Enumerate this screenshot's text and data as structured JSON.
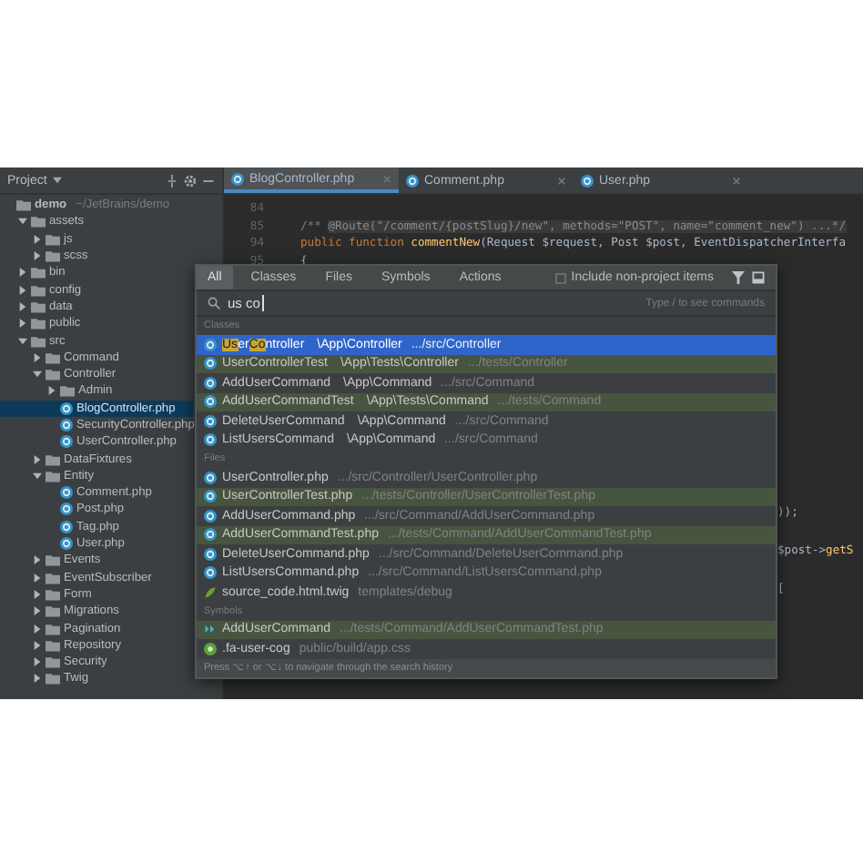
{
  "project_panel": {
    "title": "Project",
    "tree": [
      {
        "name": "demo",
        "path": "~/JetBrains/demo",
        "kind": "folder",
        "selected": false,
        "children": [
          {
            "name": "assets",
            "kind": "folder",
            "expanded": true,
            "selected": false,
            "children": [
              {
                "name": "js",
                "kind": "folder",
                "expanded": false,
                "selected": false
              },
              {
                "name": "scss",
                "kind": "folder",
                "expanded": false,
                "selected": false
              }
            ]
          },
          {
            "name": "bin",
            "kind": "folder",
            "expanded": false,
            "selected": false
          },
          {
            "name": "config",
            "kind": "folder",
            "expanded": false,
            "selected": false
          },
          {
            "name": "data",
            "kind": "folder",
            "expanded": false,
            "selected": false
          },
          {
            "name": "public",
            "kind": "folder",
            "expanded": false,
            "selected": false
          },
          {
            "name": "src",
            "kind": "folder",
            "expanded": true,
            "selected": false,
            "children": [
              {
                "name": "Command",
                "kind": "folder",
                "expanded": false,
                "selected": false
              },
              {
                "name": "Controller",
                "kind": "folder",
                "expanded": true,
                "selected": false,
                "children": [
                  {
                    "name": "Admin",
                    "kind": "folder",
                    "expanded": false,
                    "selected": false
                  },
                  {
                    "name": "BlogController.php",
                    "kind": "php",
                    "selected": true
                  },
                  {
                    "name": "SecurityController.php",
                    "kind": "php",
                    "selected": false
                  },
                  {
                    "name": "UserController.php",
                    "kind": "php",
                    "selected": false
                  }
                ]
              },
              {
                "name": "DataFixtures",
                "kind": "folder",
                "expanded": false,
                "selected": false
              },
              {
                "name": "Entity",
                "kind": "folder",
                "expanded": true,
                "selected": false,
                "children": [
                  {
                    "name": "Comment.php",
                    "kind": "php",
                    "selected": false
                  },
                  {
                    "name": "Post.php",
                    "kind": "php",
                    "selected": false
                  },
                  {
                    "name": "Tag.php",
                    "kind": "php",
                    "selected": false
                  },
                  {
                    "name": "User.php",
                    "kind": "php",
                    "selected": false
                  }
                ]
              },
              {
                "name": "Events",
                "kind": "folder",
                "expanded": false,
                "selected": false
              },
              {
                "name": "EventSubscriber",
                "kind": "folder",
                "expanded": false,
                "selected": false
              },
              {
                "name": "Form",
                "kind": "folder",
                "expanded": false,
                "selected": false
              },
              {
                "name": "Migrations",
                "kind": "folder",
                "expanded": false,
                "selected": false
              },
              {
                "name": "Pagination",
                "kind": "folder",
                "expanded": false,
                "selected": false
              },
              {
                "name": "Repository",
                "kind": "folder",
                "expanded": false,
                "selected": false
              },
              {
                "name": "Security",
                "kind": "folder",
                "expanded": false,
                "selected": false
              },
              {
                "name": "Twig",
                "kind": "folder",
                "expanded": false,
                "selected": false
              }
            ]
          }
        ]
      }
    ]
  },
  "tabs": [
    {
      "label": "BlogController.php",
      "selected": true
    },
    {
      "label": "Comment.php",
      "selected": false
    },
    {
      "label": "User.php",
      "selected": false
    }
  ],
  "editor": {
    "lines": [
      {
        "number": "84"
      },
      {
        "number": "85",
        "tokens": [
          {
            "text": "/** ",
            "kind": "comment"
          },
          {
            "text": "@Route(\"/comment/{postSlug}/new\", methods=\"POST\", name=\"comment_new\") ...*/",
            "kind": "folded"
          }
        ]
      },
      {
        "number": "94",
        "tokens": [
          {
            "text": "public function ",
            "kind": "keyword"
          },
          {
            "text": "commentNew",
            "kind": "method"
          },
          {
            "text": "(Request $request, Post $post, EventDispatcherInterfa",
            "kind": "plain"
          }
        ]
      },
      {
        "number": "95",
        "tokens": [
          {
            "text": "{",
            "kind": "plain"
          }
        ]
      }
    ],
    "tail_lines": [
      {
        "tokens": [
          {
            "text": "));",
            "kind": "plain"
          }
        ]
      },
      {
        "tokens": [
          {
            "text": "$post->",
            "kind": "plain"
          },
          {
            "text": "getS",
            "kind": "method"
          }
        ]
      },
      {
        "tokens": [
          {
            "text": "[",
            "kind": "plain"
          }
        ]
      }
    ]
  },
  "search_popup": {
    "tabs": [
      {
        "label": "All",
        "selected": true
      },
      {
        "label": "Classes",
        "selected": false
      },
      {
        "label": "Files",
        "selected": false
      },
      {
        "label": "Symbols",
        "selected": false
      },
      {
        "label": "Actions",
        "selected": false
      }
    ],
    "include_non_project": {
      "label": "Include non-project items",
      "checked": false
    },
    "query": "us co",
    "hint": "Type / to see commands",
    "sections": [
      {
        "title": "Classes",
        "items": [
          {
            "kind": "class",
            "name_parts": [
              {
                "text": "Us",
                "match": true
              },
              {
                "text": "er",
                "match": false
              },
              {
                "text": "Co",
                "match": true
              },
              {
                "text": "ntroller",
                "match": false
              }
            ],
            "qualifier": "\\App\\Controller",
            "location": ".../src/Controller",
            "selected": true,
            "test_scope": false
          },
          {
            "kind": "class",
            "name": "UserControllerTest",
            "qualifier": "\\App\\Tests\\Controller",
            "location": ".../tests/Controller",
            "selected": false,
            "test_scope": true
          },
          {
            "kind": "class",
            "name": "AddUserCommand",
            "qualifier": "\\App\\Command",
            "location": ".../src/Command",
            "selected": false,
            "test_scope": false
          },
          {
            "kind": "class",
            "name": "AddUserCommandTest",
            "qualifier": "\\App\\Tests\\Command",
            "location": ".../tests/Command",
            "selected": false,
            "test_scope": true
          },
          {
            "kind": "class",
            "name": "DeleteUserCommand",
            "qualifier": "\\App\\Command",
            "location": ".../src/Command",
            "selected": false,
            "test_scope": false
          },
          {
            "kind": "class",
            "name": "ListUsersCommand",
            "qualifier": "\\App\\Command",
            "location": ".../src/Command",
            "selected": false,
            "test_scope": false
          }
        ]
      },
      {
        "title": "Files",
        "items": [
          {
            "kind": "class",
            "name": "UserController.php",
            "location": ".../src/Controller/UserController.php",
            "selected": false,
            "test_scope": false
          },
          {
            "kind": "class",
            "name": "UserControllerTest.php",
            "location": ".../tests/Controller/UserControllerTest.php",
            "selected": false,
            "test_scope": true
          },
          {
            "kind": "class",
            "name": "AddUserCommand.php",
            "location": ".../src/Command/AddUserCommand.php",
            "selected": false,
            "test_scope": false
          },
          {
            "kind": "class",
            "name": "AddUserCommandTest.php",
            "location": ".../tests/Command/AddUserCommandTest.php",
            "selected": false,
            "test_scope": true
          },
          {
            "kind": "class",
            "name": "DeleteUserCommand.php",
            "location": ".../src/Command/DeleteUserCommand.php",
            "selected": false,
            "test_scope": false
          },
          {
            "kind": "class",
            "name": "ListUsersCommand.php",
            "location": ".../src/Command/ListUsersCommand.php",
            "selected": false,
            "test_scope": false
          },
          {
            "kind": "twig",
            "name": "source_code.html.twig",
            "location": "templates/debug",
            "selected": false,
            "test_scope": false
          }
        ]
      },
      {
        "title": "Symbols",
        "items": [
          {
            "kind": "symbol",
            "name": "AddUserCommand",
            "location": ".../tests/Command/AddUserCommandTest.php",
            "selected": false,
            "test_scope": true
          },
          {
            "kind": "css",
            "name": ".fa-user-cog",
            "location": "public/build/app.css",
            "selected": false,
            "test_scope": false
          }
        ]
      }
    ],
    "footer": "Press ⌥↑ or ⌥↓ to navigate through the search history"
  }
}
